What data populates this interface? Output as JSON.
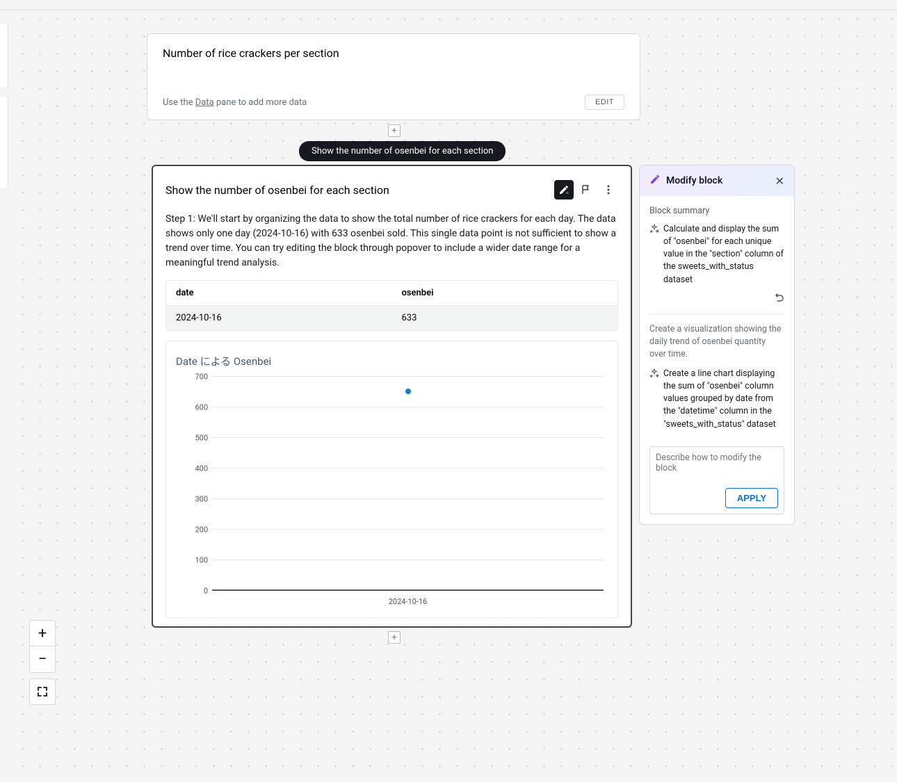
{
  "top_card": {
    "title": "Number of rice crackers per section",
    "hint_prefix": "Use the ",
    "hint_link": "Data",
    "hint_suffix": " pane to add more data",
    "edit_label": "EDIT"
  },
  "tooltip": "Show the number of osenbei for each section",
  "main_card": {
    "title": "Show the number of osenbei for each section",
    "step_text": "Step 1: We'll start by organizing the data to show the total number of rice crackers for each day. The data shows only one day (2024-10-16) with 633 osenbei sold. This single data point is not sufficient to show a trend over time. You can try editing the block through popover to include a wider date range for a meaningful trend analysis.",
    "table": {
      "headers": [
        "date",
        "osenbei"
      ],
      "rows": [
        [
          "2024-10-16",
          "633"
        ]
      ]
    }
  },
  "chart_data": {
    "type": "scatter",
    "title": "Date による Osenbei",
    "xlabel": "",
    "ylabel": "",
    "ylim": [
      0,
      700
    ],
    "yticks": [
      0,
      100,
      200,
      300,
      400,
      500,
      600,
      700
    ],
    "categories": [
      "2024-10-16"
    ],
    "values": [
      633
    ]
  },
  "modify_panel": {
    "title": "Modify block",
    "summary_label": "Block summary",
    "summary_item": "Calculate and display the sum of \"osenbei\" for each unique value in the \"section\" column of the sweets_with_status dataset",
    "suggestion_intro": "Create a visualization showing the daily trend of osenbei quantity over time.",
    "suggestion_item": "Create a line chart displaying the sum of \"osenbei\" column values grouped by date from the \"datetime\" column in the \"sweets_with_status\" dataset",
    "placeholder": "Describe how to modify the block",
    "apply_label": "APPLY"
  }
}
